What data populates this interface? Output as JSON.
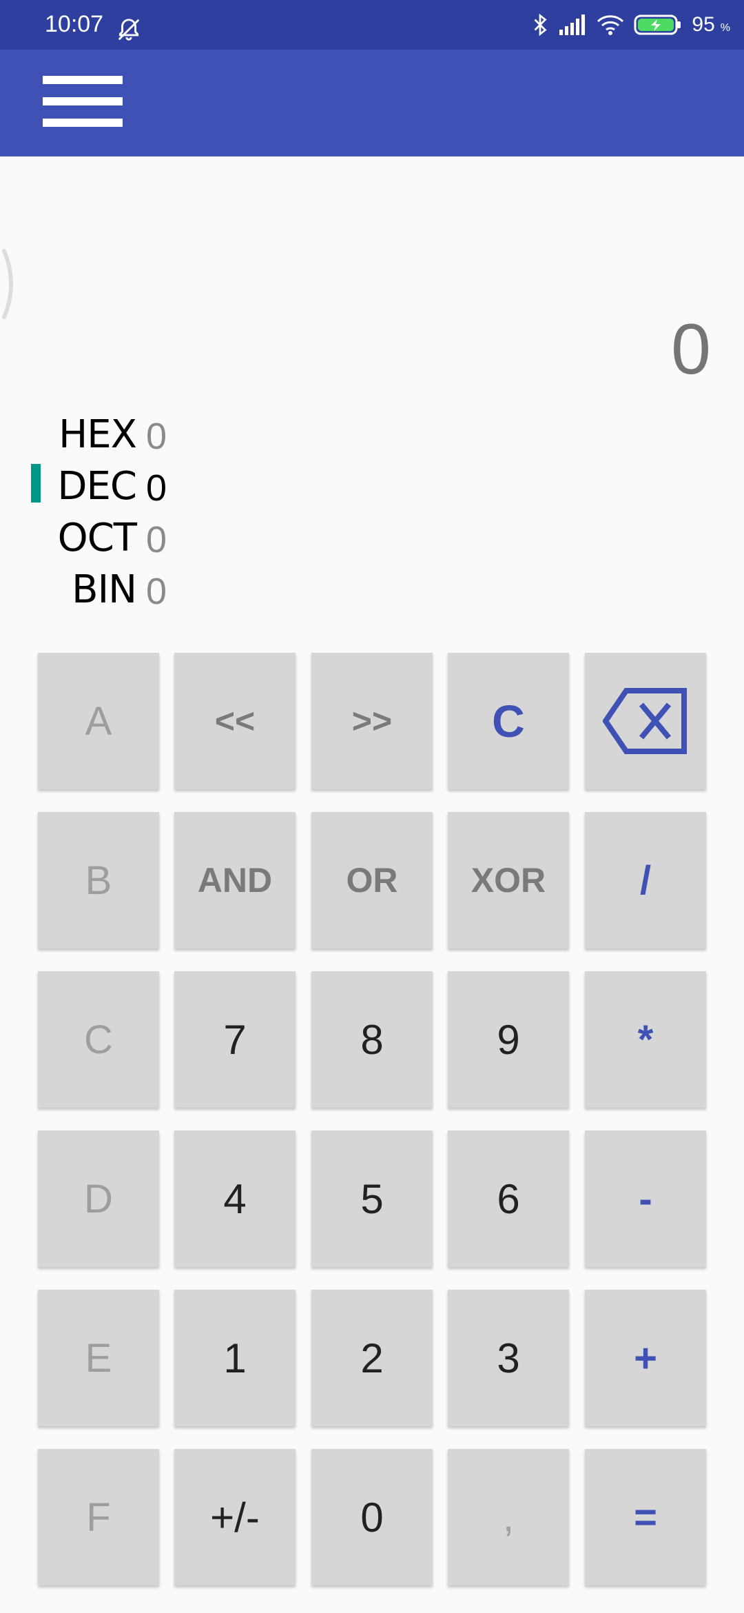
{
  "status_bar": {
    "time": "10:07",
    "battery": "95",
    "battery_unit": "%",
    "icons": [
      "bell-off-icon",
      "bluetooth-icon",
      "signal-icon",
      "wifi-icon",
      "battery-charging-icon"
    ]
  },
  "app_bar": {
    "menu_icon": "hamburger-menu-icon",
    "color": "#3f51b5"
  },
  "display": {
    "value": "0"
  },
  "bases": [
    {
      "name": "HEX",
      "value": "0",
      "active": false
    },
    {
      "name": "DEC",
      "value": "0",
      "active": true
    },
    {
      "name": "OCT",
      "value": "0",
      "active": false
    },
    {
      "name": "BIN",
      "value": "0",
      "active": false
    }
  ],
  "keypad": {
    "row1": [
      "A",
      "<<",
      ">>",
      "C",
      "⌫"
    ],
    "row2": [
      "B",
      "AND",
      "OR",
      "XOR",
      "/"
    ],
    "row3": [
      "C",
      "7",
      "8",
      "9",
      "*"
    ],
    "row4": [
      "D",
      "4",
      "5",
      "6",
      "-"
    ],
    "row5": [
      "E",
      "1",
      "2",
      "3",
      "+"
    ],
    "row6": [
      "F",
      "+/-",
      "0",
      ",",
      "="
    ]
  },
  "colors": {
    "primary": "#3f51b5",
    "status_bar": "#2f3f9f",
    "active_indicator": "#009688",
    "key_background": "#d6d6d6"
  }
}
